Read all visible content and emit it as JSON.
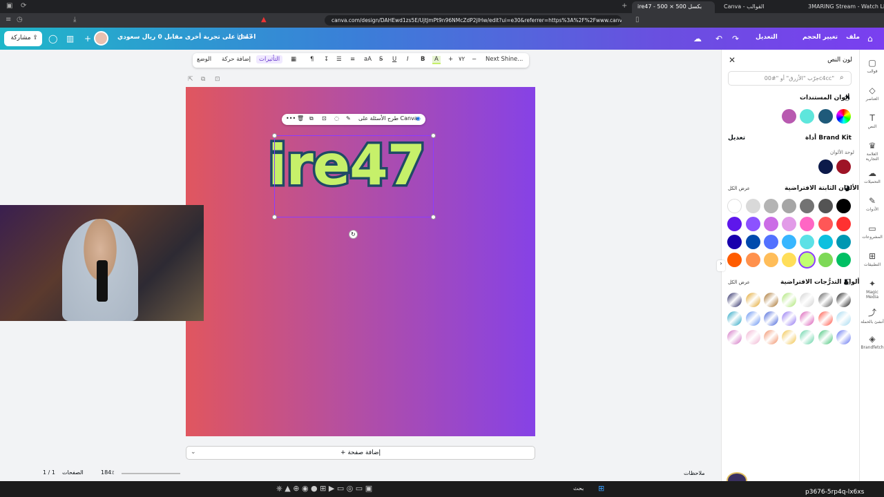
{
  "browser": {
    "tabs": [
      {
        "label": "ire47 - 500 × 500 بكسل"
      },
      {
        "label": "Canva - القوالب"
      },
      {
        "label": "3MARING Stream - Watch Live on Kick"
      }
    ],
    "url": "canva.com/design/DAHEwd1zs5E/UjtJmPt9n96NMcZdP2jlHw/edit?ui=e30&referrer=https%3A%2F%2Fwww.canva.com%2Ftemplates"
  },
  "topbar": {
    "share_label": "مشاركة",
    "promo": "احصل على تجربة أخرى مقابل 0 ريال سعودي",
    "design_name": "ire47",
    "file": "ملف",
    "resize": "تغيير الحجم",
    "edit": "التعديل"
  },
  "toolbar": {
    "font": "Next Shine...",
    "size": "٧٢",
    "effects": "التأثيرات",
    "animate": "إضافة حركة",
    "position": "الوضع",
    "plus": "+",
    "minus": "−"
  },
  "minibar": {
    "ask": "طرح الأسئلة على Canva"
  },
  "canvas": {
    "text": "ire47",
    "add_page": "+ إضافة صفحة"
  },
  "panel": {
    "title": "لون النص",
    "search_placeholder": "جرّب \"الأزرق\" أو \"#00c4cc\"",
    "doc_colors": "ألوان المستندات",
    "brand_kit": "أداة Brand Kit",
    "brand_edit": "تعديل",
    "palette_label": "لوحة الألوان",
    "defaults": "الألوان الثابتة الافتراضية",
    "see_all": "عرض الكل",
    "gradients": "ألوان التدرُّجات الافتراضية",
    "see_all2": "عرض الكل",
    "doc_swatches": [
      "#b85ab0",
      "#5ee6dc",
      "#1f5a7a",
      "rainbow"
    ],
    "brand_swatches": [
      "#0c1a4a",
      "#9e1426"
    ],
    "solid_rows": [
      [
        "#000000",
        "#545454",
        "#737373",
        "#a6a6a6",
        "#b4b4b4",
        "#d9d9d9",
        "#ffffff"
      ],
      [
        "#ff3131",
        "#ff5757",
        "#ff66c4",
        "#e29be8",
        "#cb6ce6",
        "#8c52ff",
        "#5e17eb"
      ],
      [
        "#0097b2",
        "#0cc0df",
        "#5ce1e6",
        "#38b6ff",
        "#5271ff",
        "#004aad",
        "#1800ad"
      ],
      [
        "#00bf63",
        "#7ed957",
        "#c1ff72",
        "#ffde59",
        "#ffbd59",
        "#ff914d",
        "#ff5c00"
      ]
    ],
    "gradient_rows": [
      [
        "#111111",
        "#555555",
        "#d0d0d0",
        "#a6e36a",
        "#a0661a",
        "#e0a020",
        "#1a1a5a"
      ],
      [
        "#a0d8ef",
        "#ff4a3a",
        "#d64fb0",
        "#8a6cf0",
        "#3a5ad8",
        "#5a8af0",
        "#1aa0c0"
      ],
      [
        "#5a6cf0",
        "#38c070",
        "#5ad0a0",
        "#f0c040",
        "#f08a60",
        "#f0b0d0",
        "#d06ac0"
      ]
    ]
  },
  "rail": [
    {
      "label": "قوالب",
      "icon": "templates-icon"
    },
    {
      "label": "العناصر",
      "icon": "elements-icon"
    },
    {
      "label": "النص",
      "icon": "text-icon"
    },
    {
      "label": "العلامة التجارية",
      "icon": "brand-icon"
    },
    {
      "label": "التحميلات",
      "icon": "uploads-icon"
    },
    {
      "label": "الأدوات",
      "icon": "tools-icon"
    },
    {
      "label": "المشروعات",
      "icon": "projects-icon"
    },
    {
      "label": "التطبيقات",
      "icon": "apps-icon"
    },
    {
      "label": "Magic Media",
      "icon": "magic-media-icon"
    },
    {
      "label": "أنشئ بالحملة",
      "icon": "campaign-icon"
    },
    {
      "label": "Brandfetch",
      "icon": "brandfetch-icon"
    }
  ],
  "bottom": {
    "zoom": "184٪",
    "pages": "1 / 1",
    "notes": "ملاحظات",
    "pages_label": "الصفحات"
  },
  "taskbar": {
    "search": "بحث",
    "host": "p3676-5rp4q-lx6xs"
  }
}
